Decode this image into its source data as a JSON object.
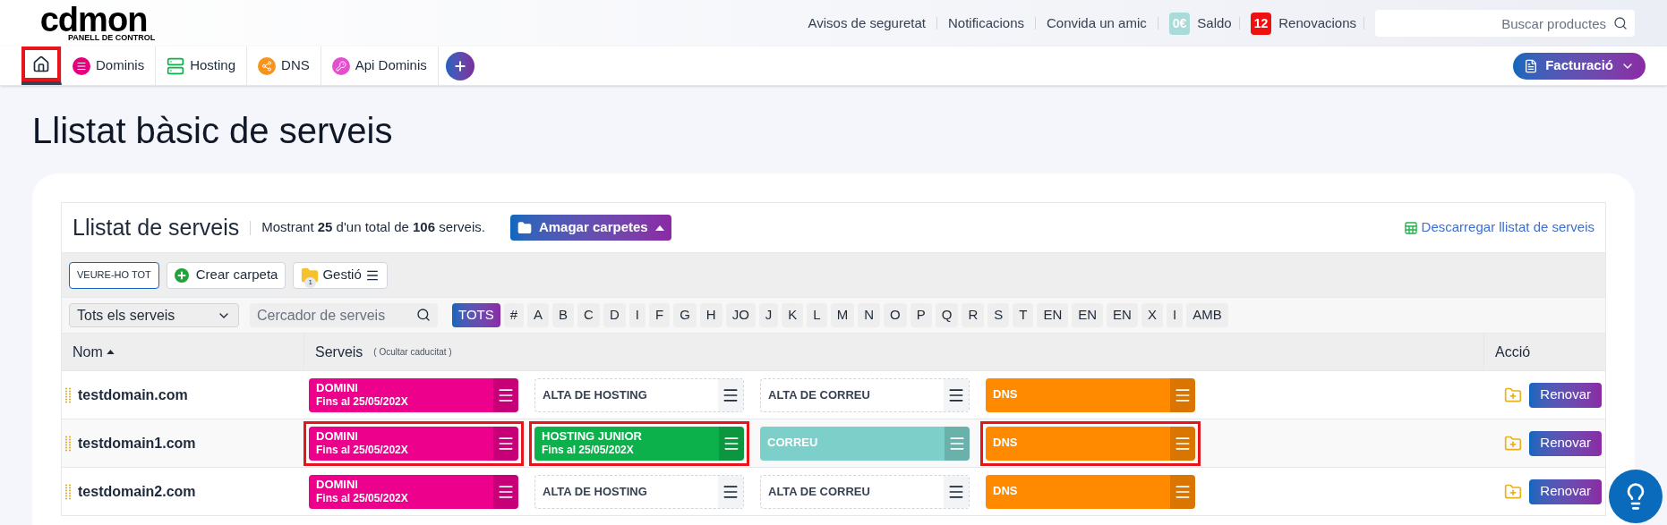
{
  "logo": {
    "name": "cdmon",
    "subtitle": "PANELL DE CONTROL"
  },
  "top_links": [
    "Avisos de seguretat",
    "Notificacions",
    "Convida un amic"
  ],
  "balance": {
    "badge": "0€",
    "label": "Saldo"
  },
  "renewals": {
    "badge": "12",
    "label": "Renovacions"
  },
  "search": {
    "placeholder": "Buscar productes"
  },
  "nav": [
    {
      "kind": "home",
      "selected": true,
      "highlighted": true
    },
    {
      "kind": "dominis",
      "label": "Dominis",
      "selected": false,
      "highlighted": false
    },
    {
      "kind": "hosting",
      "label": "Hosting",
      "selected": false,
      "highlighted": false
    },
    {
      "kind": "dns",
      "label": "DNS",
      "selected": false,
      "highlighted": false
    },
    {
      "kind": "api",
      "label": "Api Dominis",
      "selected": false,
      "highlighted": false
    }
  ],
  "billing_button": "Facturació",
  "page_title": "Llistat bàsic de serveis",
  "panel": {
    "title": "Llistat de serveis",
    "summary": "Mostrant **25** d'un total de **106** serveis.",
    "folders_button": "Amagar carpetes",
    "download_link": "Descarregar llistat de serveis"
  },
  "toolbar": {
    "view_all": "VEURE-HO TOT",
    "create_folder": "Crear carpeta",
    "manage": "Gestió",
    "manage_count": "1"
  },
  "filter": {
    "select": "Tots els serveis",
    "search_placeholder": "Cercador de serveis"
  },
  "letters": [
    {
      "label": "TOTS",
      "selected": true
    },
    {
      "label": "#",
      "selected": false
    },
    {
      "label": "A",
      "selected": false
    },
    {
      "label": "B",
      "selected": false
    },
    {
      "label": "C",
      "selected": false
    },
    {
      "label": "D",
      "selected": false
    },
    {
      "label": "I",
      "selected": false
    },
    {
      "label": "F",
      "selected": false
    },
    {
      "label": "G",
      "selected": false
    },
    {
      "label": "H",
      "selected": false
    },
    {
      "label": "JO",
      "selected": false
    },
    {
      "label": "J",
      "selected": false
    },
    {
      "label": "K",
      "selected": false
    },
    {
      "label": "L",
      "selected": false
    },
    {
      "label": "M",
      "selected": false
    },
    {
      "label": "N",
      "selected": false
    },
    {
      "label": "O",
      "selected": false
    },
    {
      "label": "P",
      "selected": false
    },
    {
      "label": "Q",
      "selected": false
    },
    {
      "label": "R",
      "selected": false
    },
    {
      "label": "S",
      "selected": false
    },
    {
      "label": "T",
      "selected": false
    },
    {
      "label": "EN",
      "selected": false
    },
    {
      "label": "EN",
      "selected": false
    },
    {
      "label": "EN",
      "selected": false
    },
    {
      "label": "X",
      "selected": false
    },
    {
      "label": "I",
      "selected": false
    },
    {
      "label": "AMB",
      "selected": false
    }
  ],
  "table": {
    "columns": [
      "Nom",
      "Serveis",
      "Acció"
    ],
    "services_note": "( Ocultar caducitat )",
    "rows": [
      {
        "name": "testdomain.com",
        "action": "Renovar",
        "services": [
          {
            "kind": "active",
            "label": "DOMINI",
            "expiry": "Fins al 25/05/202X",
            "color": "#ec008c",
            "highlighted": false
          },
          {
            "kind": "empty",
            "label": "ALTA DE HOSTING",
            "highlighted": false
          },
          {
            "kind": "empty",
            "label": "ALTA DE CORREU",
            "highlighted": false
          },
          {
            "kind": "active",
            "label": "DNS",
            "color": "#ff8a00",
            "highlighted": false
          }
        ]
      },
      {
        "name": "testdomain1.com",
        "action": "Renovar",
        "services": [
          {
            "kind": "active",
            "label": "DOMINI",
            "expiry": "Fins al 25/05/202X",
            "color": "#ec008c",
            "highlighted": true
          },
          {
            "kind": "active",
            "label": "HOSTING JUNIOR",
            "expiry": "Fins al 25/05/202X",
            "color": "#0db14b",
            "highlighted": true
          },
          {
            "kind": "active",
            "label": "CORREU",
            "color": "#7dcfc9",
            "highlighted": false
          },
          {
            "kind": "active",
            "label": "DNS",
            "color": "#ff8a00",
            "highlighted": true
          }
        ]
      },
      {
        "name": "testdomain2.com",
        "action": "Renovar",
        "services": [
          {
            "kind": "active",
            "label": "DOMINI",
            "expiry": "Fins al 25/05/202X",
            "color": "#ec008c",
            "highlighted": false
          },
          {
            "kind": "empty",
            "label": "ALTA DE HOSTING",
            "highlighted": false
          },
          {
            "kind": "empty",
            "label": "ALTA DE CORREU",
            "highlighted": false
          },
          {
            "kind": "active",
            "label": "DNS",
            "color": "#ff8a00",
            "highlighted": false
          }
        ]
      }
    ]
  }
}
